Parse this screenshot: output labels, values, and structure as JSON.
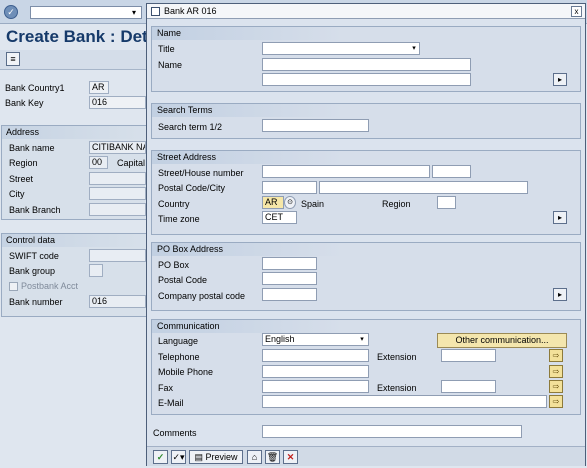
{
  "background": {
    "title": "Create Bank : Detail :",
    "fields": {
      "bank_country_label": "Bank Country1",
      "bank_country_value": "AR",
      "bank_key_label": "Bank Key",
      "bank_key_value": "016"
    },
    "address": {
      "header": "Address",
      "bank_name_label": "Bank name",
      "bank_name_value": "CITIBANK NA",
      "region_label": "Region",
      "region_value": "00",
      "region_extra": "Capital",
      "street_label": "Street",
      "city_label": "City",
      "branch_label": "Bank Branch"
    },
    "control": {
      "header": "Control data",
      "swift_label": "SWIFT code",
      "group_label": "Bank group",
      "postbank_label": "Postbank Acct",
      "number_label": "Bank number",
      "number_value": "016"
    }
  },
  "dialog": {
    "title": "Bank AR 016",
    "close": "x",
    "name": {
      "header": "Name",
      "title_label": "Title",
      "name_label": "Name"
    },
    "search": {
      "header": "Search Terms",
      "term_label": "Search term 1/2"
    },
    "street": {
      "header": "Street Address",
      "street_label": "Street/House number",
      "postal_label": "Postal Code/City",
      "country_label": "Country",
      "country_value": "AR",
      "country_name": "Spain",
      "region_label": "Region",
      "timezone_label": "Time zone",
      "timezone_value": "CET"
    },
    "pobox": {
      "header": "PO Box Address",
      "pobox_label": "PO Box",
      "postal_label": "Postal Code",
      "company_label": "Company postal code"
    },
    "communication": {
      "header": "Communication",
      "language_label": "Language",
      "language_value": "English",
      "other_button": "Other communication...",
      "telephone_label": "Telephone",
      "extension_label": "Extension",
      "mobile_label": "Mobile Phone",
      "fax_label": "Fax",
      "fax_extension_label": "Extension",
      "email_label": "E-Mail"
    },
    "comments_label": "Comments",
    "footer": {
      "preview_label": "Preview"
    }
  },
  "colors": {
    "title_text": "#163a6a",
    "section_bg": "#d6deea",
    "button_yellow": "#f3e19a",
    "cancel_red": "#c0201c",
    "check_green": "#2f8a2f"
  }
}
